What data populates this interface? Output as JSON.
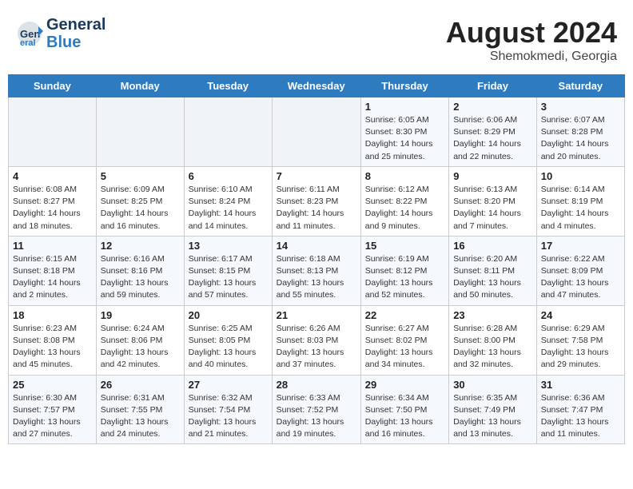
{
  "header": {
    "logo_general": "General",
    "logo_blue": "Blue",
    "title": "August 2024",
    "subtitle": "Shemokmedi, Georgia"
  },
  "calendar": {
    "days_of_week": [
      "Sunday",
      "Monday",
      "Tuesday",
      "Wednesday",
      "Thursday",
      "Friday",
      "Saturday"
    ],
    "weeks": [
      [
        {
          "day": "",
          "info": ""
        },
        {
          "day": "",
          "info": ""
        },
        {
          "day": "",
          "info": ""
        },
        {
          "day": "",
          "info": ""
        },
        {
          "day": "1",
          "info": "Sunrise: 6:05 AM\nSunset: 8:30 PM\nDaylight: 14 hours\nand 25 minutes."
        },
        {
          "day": "2",
          "info": "Sunrise: 6:06 AM\nSunset: 8:29 PM\nDaylight: 14 hours\nand 22 minutes."
        },
        {
          "day": "3",
          "info": "Sunrise: 6:07 AM\nSunset: 8:28 PM\nDaylight: 14 hours\nand 20 minutes."
        }
      ],
      [
        {
          "day": "4",
          "info": "Sunrise: 6:08 AM\nSunset: 8:27 PM\nDaylight: 14 hours\nand 18 minutes."
        },
        {
          "day": "5",
          "info": "Sunrise: 6:09 AM\nSunset: 8:25 PM\nDaylight: 14 hours\nand 16 minutes."
        },
        {
          "day": "6",
          "info": "Sunrise: 6:10 AM\nSunset: 8:24 PM\nDaylight: 14 hours\nand 14 minutes."
        },
        {
          "day": "7",
          "info": "Sunrise: 6:11 AM\nSunset: 8:23 PM\nDaylight: 14 hours\nand 11 minutes."
        },
        {
          "day": "8",
          "info": "Sunrise: 6:12 AM\nSunset: 8:22 PM\nDaylight: 14 hours\nand 9 minutes."
        },
        {
          "day": "9",
          "info": "Sunrise: 6:13 AM\nSunset: 8:20 PM\nDaylight: 14 hours\nand 7 minutes."
        },
        {
          "day": "10",
          "info": "Sunrise: 6:14 AM\nSunset: 8:19 PM\nDaylight: 14 hours\nand 4 minutes."
        }
      ],
      [
        {
          "day": "11",
          "info": "Sunrise: 6:15 AM\nSunset: 8:18 PM\nDaylight: 14 hours\nand 2 minutes."
        },
        {
          "day": "12",
          "info": "Sunrise: 6:16 AM\nSunset: 8:16 PM\nDaylight: 13 hours\nand 59 minutes."
        },
        {
          "day": "13",
          "info": "Sunrise: 6:17 AM\nSunset: 8:15 PM\nDaylight: 13 hours\nand 57 minutes."
        },
        {
          "day": "14",
          "info": "Sunrise: 6:18 AM\nSunset: 8:13 PM\nDaylight: 13 hours\nand 55 minutes."
        },
        {
          "day": "15",
          "info": "Sunrise: 6:19 AM\nSunset: 8:12 PM\nDaylight: 13 hours\nand 52 minutes."
        },
        {
          "day": "16",
          "info": "Sunrise: 6:20 AM\nSunset: 8:11 PM\nDaylight: 13 hours\nand 50 minutes."
        },
        {
          "day": "17",
          "info": "Sunrise: 6:22 AM\nSunset: 8:09 PM\nDaylight: 13 hours\nand 47 minutes."
        }
      ],
      [
        {
          "day": "18",
          "info": "Sunrise: 6:23 AM\nSunset: 8:08 PM\nDaylight: 13 hours\nand 45 minutes."
        },
        {
          "day": "19",
          "info": "Sunrise: 6:24 AM\nSunset: 8:06 PM\nDaylight: 13 hours\nand 42 minutes."
        },
        {
          "day": "20",
          "info": "Sunrise: 6:25 AM\nSunset: 8:05 PM\nDaylight: 13 hours\nand 40 minutes."
        },
        {
          "day": "21",
          "info": "Sunrise: 6:26 AM\nSunset: 8:03 PM\nDaylight: 13 hours\nand 37 minutes."
        },
        {
          "day": "22",
          "info": "Sunrise: 6:27 AM\nSunset: 8:02 PM\nDaylight: 13 hours\nand 34 minutes."
        },
        {
          "day": "23",
          "info": "Sunrise: 6:28 AM\nSunset: 8:00 PM\nDaylight: 13 hours\nand 32 minutes."
        },
        {
          "day": "24",
          "info": "Sunrise: 6:29 AM\nSunset: 7:58 PM\nDaylight: 13 hours\nand 29 minutes."
        }
      ],
      [
        {
          "day": "25",
          "info": "Sunrise: 6:30 AM\nSunset: 7:57 PM\nDaylight: 13 hours\nand 27 minutes."
        },
        {
          "day": "26",
          "info": "Sunrise: 6:31 AM\nSunset: 7:55 PM\nDaylight: 13 hours\nand 24 minutes."
        },
        {
          "day": "27",
          "info": "Sunrise: 6:32 AM\nSunset: 7:54 PM\nDaylight: 13 hours\nand 21 minutes."
        },
        {
          "day": "28",
          "info": "Sunrise: 6:33 AM\nSunset: 7:52 PM\nDaylight: 13 hours\nand 19 minutes."
        },
        {
          "day": "29",
          "info": "Sunrise: 6:34 AM\nSunset: 7:50 PM\nDaylight: 13 hours\nand 16 minutes."
        },
        {
          "day": "30",
          "info": "Sunrise: 6:35 AM\nSunset: 7:49 PM\nDaylight: 13 hours\nand 13 minutes."
        },
        {
          "day": "31",
          "info": "Sunrise: 6:36 AM\nSunset: 7:47 PM\nDaylight: 13 hours\nand 11 minutes."
        }
      ]
    ]
  }
}
